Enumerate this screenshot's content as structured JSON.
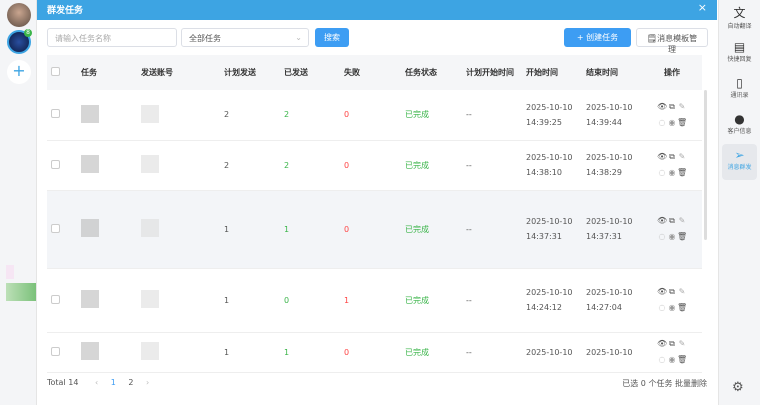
{
  "modal": {
    "title": "群发任务",
    "close": "×"
  },
  "toolbar": {
    "search_placeholder": "请输入任务名称",
    "filter_value": "全部任务",
    "search_label": "搜索",
    "create_label": "+ 创建任务",
    "template_label": "消息模板管理"
  },
  "table": {
    "headers": [
      "任务",
      "发送账号",
      "计划发送",
      "已发送",
      "失败",
      "任务状态",
      "计划开始时间",
      "开始时间",
      "结束时间",
      "操作"
    ],
    "rows": [
      {
        "planned": "2",
        "sent": "2",
        "failed": "0",
        "status": "已完成",
        "plan_start": "--",
        "start_date": "2025-10-10",
        "start_time": "14:39:25",
        "end_date": "2025-10-10",
        "end_time": "14:39:44"
      },
      {
        "planned": "2",
        "sent": "2",
        "failed": "0",
        "status": "已完成",
        "plan_start": "--",
        "start_date": "2025-10-10",
        "start_time": "14:38:10",
        "end_date": "2025-10-10",
        "end_time": "14:38:29"
      },
      {
        "planned": "1",
        "sent": "1",
        "failed": "0",
        "status": "已完成",
        "plan_start": "--",
        "start_date": "2025-10-10",
        "start_time": "14:37:31",
        "end_date": "2025-10-10",
        "end_time": "14:37:31"
      },
      {
        "planned": "1",
        "sent": "0",
        "failed": "1",
        "status": "已完成",
        "plan_start": "--",
        "start_date": "2025-10-10",
        "start_time": "14:24:12",
        "end_date": "2025-10-10",
        "end_time": "14:27:04"
      },
      {
        "planned": "1",
        "sent": "1",
        "failed": "0",
        "status": "已完成",
        "plan_start": "--",
        "start_date": "2025-10-10",
        "start_time": "",
        "end_date": "2025-10-10",
        "end_time": ""
      }
    ]
  },
  "footer": {
    "total": "Total 14",
    "pages": [
      "1",
      "2"
    ],
    "selected": "已选 0 个任务",
    "batch_delete": "批量删除"
  },
  "sidebar": {
    "badge": "8",
    "items": [
      "自动翻译",
      "快捷回复",
      "通讯录",
      "客户信息",
      "消息群发"
    ]
  }
}
